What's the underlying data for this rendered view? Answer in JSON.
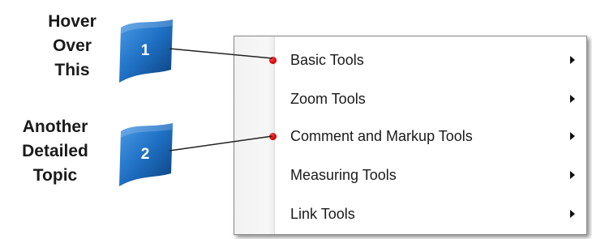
{
  "callouts": [
    {
      "number": "1",
      "lines": [
        "Hover",
        "Over",
        "This"
      ]
    },
    {
      "number": "2",
      "lines": [
        "Another",
        "Detailed",
        "Topic"
      ]
    }
  ],
  "menu": {
    "items": [
      {
        "label": "Basic Tools",
        "has_submenu": true,
        "hotspot": true
      },
      {
        "label": "Zoom Tools",
        "has_submenu": true,
        "hotspot": false
      },
      {
        "label": "Comment and Markup Tools",
        "has_submenu": true,
        "hotspot": true
      },
      {
        "label": "Measuring Tools",
        "has_submenu": true,
        "hotspot": false
      },
      {
        "label": "Link Tools",
        "has_submenu": true,
        "hotspot": false
      }
    ]
  },
  "colors": {
    "flag_fill": "#1e6fc2",
    "flag_dark": "#0d3f7a",
    "hotspot": "#d80000",
    "connector": "#222222"
  },
  "icons": {
    "submenu_arrow": "chevron-right-icon",
    "flag": "flag-badge-icon",
    "hotspot": "hotspot-dot-icon"
  }
}
